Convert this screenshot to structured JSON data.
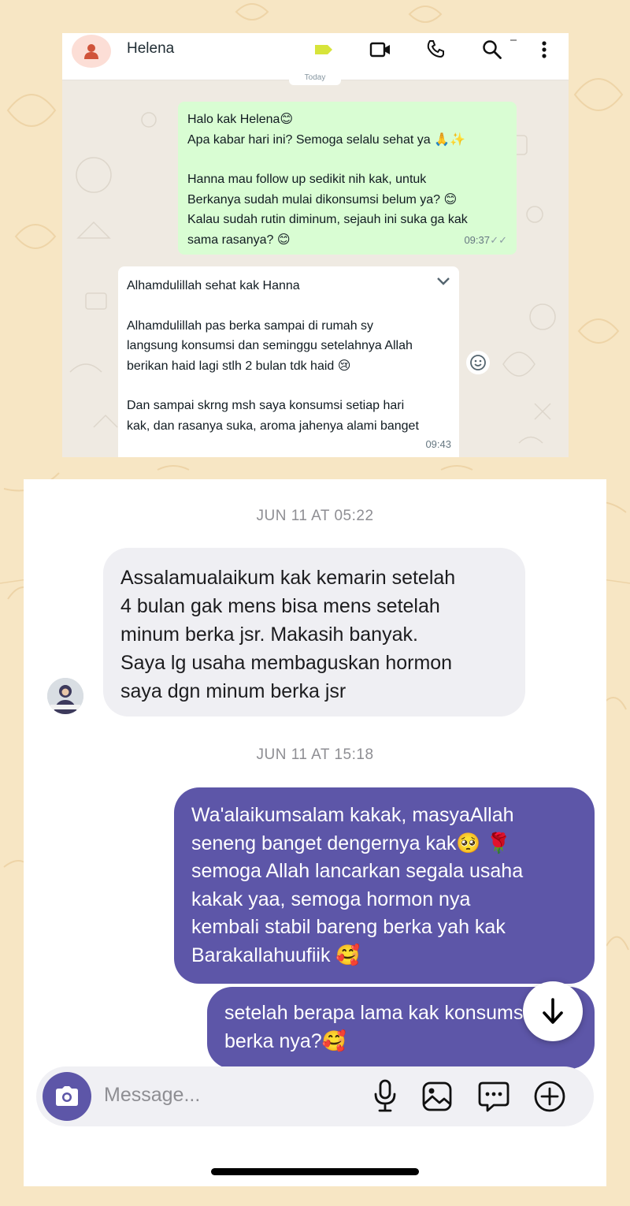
{
  "whatsapp": {
    "contact_name": "Helena",
    "date_pill": "Today",
    "outgoing": {
      "lines": [
        "Halo kak Helena😊",
        "Apa kabar hari ini? Semoga selalu sehat ya 🙏✨",
        "",
        "Hanna mau follow up sedikit nih kak, untuk",
        "Berkanya sudah mulai dikonsumsi belum ya? 😊",
        "Kalau sudah rutin diminum, sejauh ini suka ga kak",
        "sama rasanya? 😊"
      ],
      "time": "09:37",
      "ticks": "✓✓"
    },
    "incoming": {
      "lines": [
        "Alhamdulillah sehat kak Hanna",
        "",
        "Alhamdulillah pas berka sampai di rumah sy",
        "langsung konsumsi dan seminggu setelahnya Allah",
        "berikan haid lagi stlh 2 bulan tdk haid 😢",
        "",
        "Dan sampai skrng msh saya konsumsi setiap hari",
        "kak, dan rasanya suka, aroma jahenya alami banget"
      ],
      "time": "09:43"
    }
  },
  "instagram": {
    "timestamp_1": "JUN 11 AT 05:22",
    "incoming_lines": [
      "Assalamualaikum kak kemarin setelah",
      "4 bulan gak mens bisa mens setelah",
      "minum berka jsr. Makasih banyak.",
      "Saya lg usaha membaguskan hormon",
      "saya dgn minum berka jsr"
    ],
    "timestamp_2": "JUN 11 AT 15:18",
    "outgoing_1_lines": [
      "Wa'alaikumsalam kakak, masyaAllah",
      "seneng banget dengernya kak🥺 🌹",
      "semoga Allah lancarkan segala usaha",
      "kakak yaa, semoga hormon nya",
      "kembali stabil bareng berka yah kak",
      "Barakallahuufiik 🥰"
    ],
    "outgoing_2_lines": [
      "setelah berapa lama kak konsumsi",
      "berka nya?🥰"
    ],
    "composer_placeholder": "Message...",
    "colors": {
      "outgoing_bubble": "#5d56a8",
      "incoming_bubble": "#efeff3",
      "whatsapp_outgoing": "#d9fdd3",
      "page_background": "#f7e6c4"
    }
  }
}
